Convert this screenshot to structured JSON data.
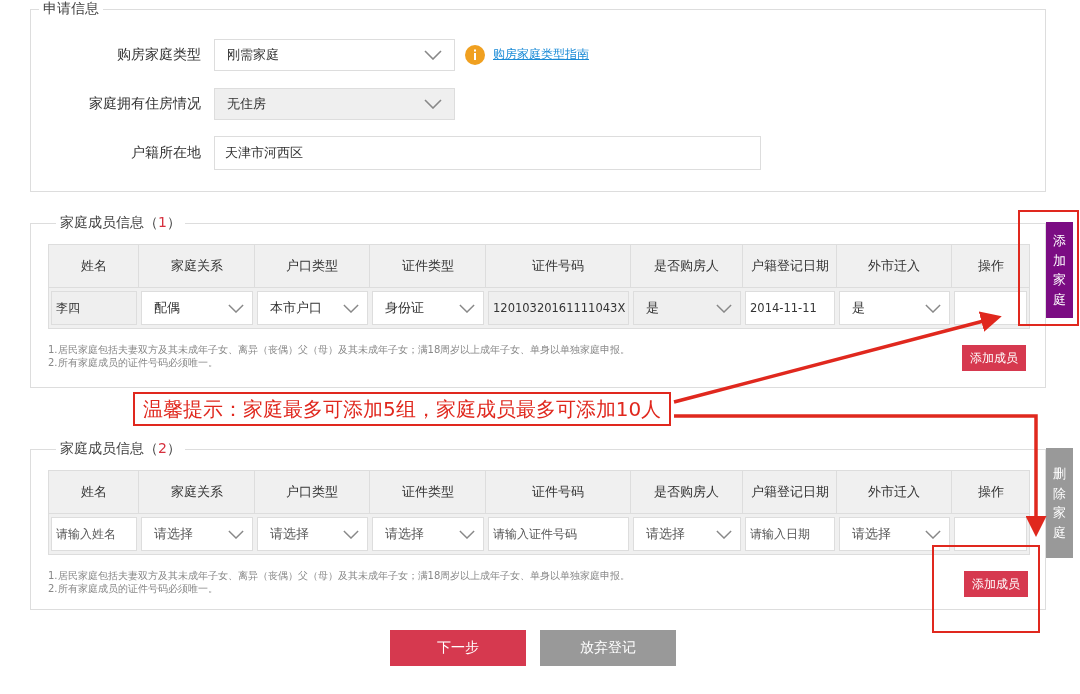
{
  "application": {
    "legend": "申请信息",
    "fields": [
      {
        "label": "购房家庭类型",
        "kind": "select",
        "value": "刚需家庭",
        "disabled": false,
        "help_link": "购房家庭类型指南"
      },
      {
        "label": "家庭拥有住房情况",
        "kind": "select",
        "value": "无住房",
        "disabled": true
      },
      {
        "label": "户籍所在地",
        "kind": "text",
        "value": "天津市河西区"
      }
    ]
  },
  "families": [
    {
      "title": "家庭成员信息（",
      "number": "1",
      "title_close": "）",
      "columns": [
        "姓名",
        "家庭关系",
        "户口类型",
        "证件类型",
        "证件号码",
        "是否购房人",
        "户籍登记日期",
        "外市迁入",
        "操作"
      ],
      "row": [
        {
          "kind": "input",
          "value": "李四",
          "disabled": true
        },
        {
          "kind": "select",
          "value": "配偶",
          "disabled": false
        },
        {
          "kind": "select",
          "value": "本市户口",
          "disabled": false
        },
        {
          "kind": "select",
          "value": "身份证",
          "disabled": false
        },
        {
          "kind": "input",
          "value": "12010320161111043X",
          "disabled": true
        },
        {
          "kind": "select",
          "value": "是",
          "disabled": true
        },
        {
          "kind": "input",
          "value": "2014-11-11",
          "disabled": false
        },
        {
          "kind": "select",
          "value": "是",
          "disabled": false
        },
        {
          "kind": "empty"
        }
      ],
      "notes": [
        "1.居民家庭包括夫妻双方及其未成年子女、离异（丧偶）父（母）及其未成年子女；满18周岁以上成年子女、单身以单独家庭申报。",
        "2.所有家庭成员的证件号码必须唯一。"
      ],
      "add_member": {
        "label": "添加成员",
        "highlighted": false
      },
      "side_button": {
        "label": "添加家庭",
        "kind": "add",
        "highlighted": true
      }
    },
    {
      "title": "家庭成员信息（",
      "number": "2",
      "title_close": "）",
      "columns": [
        "姓名",
        "家庭关系",
        "户口类型",
        "证件类型",
        "证件号码",
        "是否购房人",
        "户籍登记日期",
        "外市迁入",
        "操作"
      ],
      "row": [
        {
          "kind": "input",
          "placeholder": "请输入姓名",
          "disabled": false
        },
        {
          "kind": "select",
          "placeholder": "请选择",
          "disabled": false
        },
        {
          "kind": "select",
          "placeholder": "请选择",
          "disabled": false
        },
        {
          "kind": "select",
          "placeholder": "请选择",
          "disabled": false
        },
        {
          "kind": "input",
          "placeholder": "请输入证件号码",
          "disabled": false
        },
        {
          "kind": "select",
          "placeholder": "请选择",
          "disabled": false
        },
        {
          "kind": "input",
          "placeholder": "请输入日期",
          "disabled": false
        },
        {
          "kind": "select",
          "placeholder": "请选择",
          "disabled": false
        },
        {
          "kind": "empty"
        }
      ],
      "notes": [
        "1.居民家庭包括夫妻双方及其未成年子女、离异（丧偶）父（母）及其未成年子女；满18周岁以上成年子女、单身以单独家庭申报。",
        "2.所有家庭成员的证件号码必须唯一。"
      ],
      "add_member": {
        "label": "添加成员",
        "highlighted": true
      },
      "side_button": {
        "label": "删除家庭",
        "kind": "delete",
        "highlighted": false
      }
    }
  ],
  "callout": "温馨提示：家庭最多可添加5组，家庭成员最多可添加10人",
  "buttons": [
    {
      "label": "下一步",
      "kind": "primary"
    },
    {
      "label": "放弃登记",
      "kind": "secondary"
    }
  ]
}
